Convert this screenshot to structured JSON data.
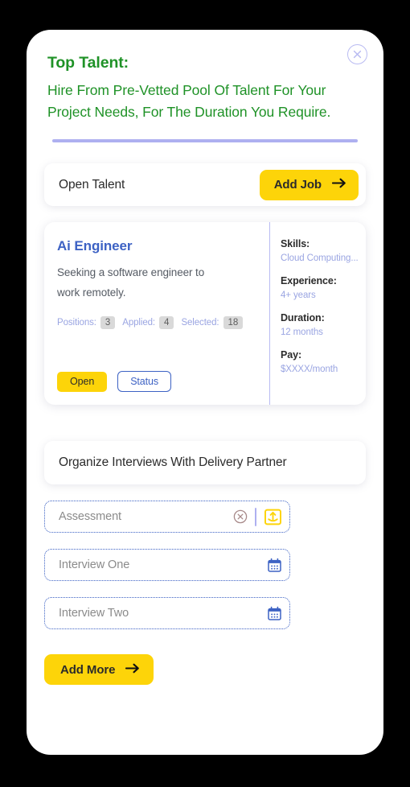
{
  "header": {
    "title": "Top Talent:",
    "subtitle": "Hire From Pre-Vetted Pool Of Talent For Your Project Needs, For The Duration You Require.",
    "close_icon": "close-circle-icon"
  },
  "talent_bar": {
    "label": "Open Talent",
    "add_job_label": "Add Job",
    "arrow_icon": "arrow-right-icon"
  },
  "job_card": {
    "title": "Ai Engineer",
    "description": "Seeking a software engineer to work remotely.",
    "stats": [
      {
        "label": "Positions:",
        "value": "3"
      },
      {
        "label": "Applied:",
        "value": "4"
      },
      {
        "label": "Selected:",
        "value": "18"
      }
    ],
    "open_label": "Open",
    "status_label": "Status",
    "meta": [
      {
        "label": "Skills:",
        "value": "Cloud Computing..."
      },
      {
        "label": "Experience:",
        "value": "4+ years"
      },
      {
        "label": "Duration:",
        "value": "12 months"
      },
      {
        "label": "Pay:",
        "value": "$XXXX/month"
      }
    ]
  },
  "organize": {
    "label": "Organize Interviews With Delivery Partner"
  },
  "fields": [
    {
      "placeholder": "Assessment",
      "remove_icon": "remove-circle-icon",
      "action_icon": "upload-icon"
    },
    {
      "placeholder": "Interview One",
      "action_icon": "calendar-icon"
    },
    {
      "placeholder": "Interview Two",
      "action_icon": "calendar-icon"
    }
  ],
  "add_more": {
    "label": "Add More",
    "arrow_icon": "arrow-right-icon"
  },
  "colors": {
    "green": "#1f9227",
    "yellow": "#fdd409",
    "blue": "#3d62c4",
    "lavender": "#aeb0f0",
    "light_blue_text": "#9aa5e2",
    "frame": "#000000"
  }
}
